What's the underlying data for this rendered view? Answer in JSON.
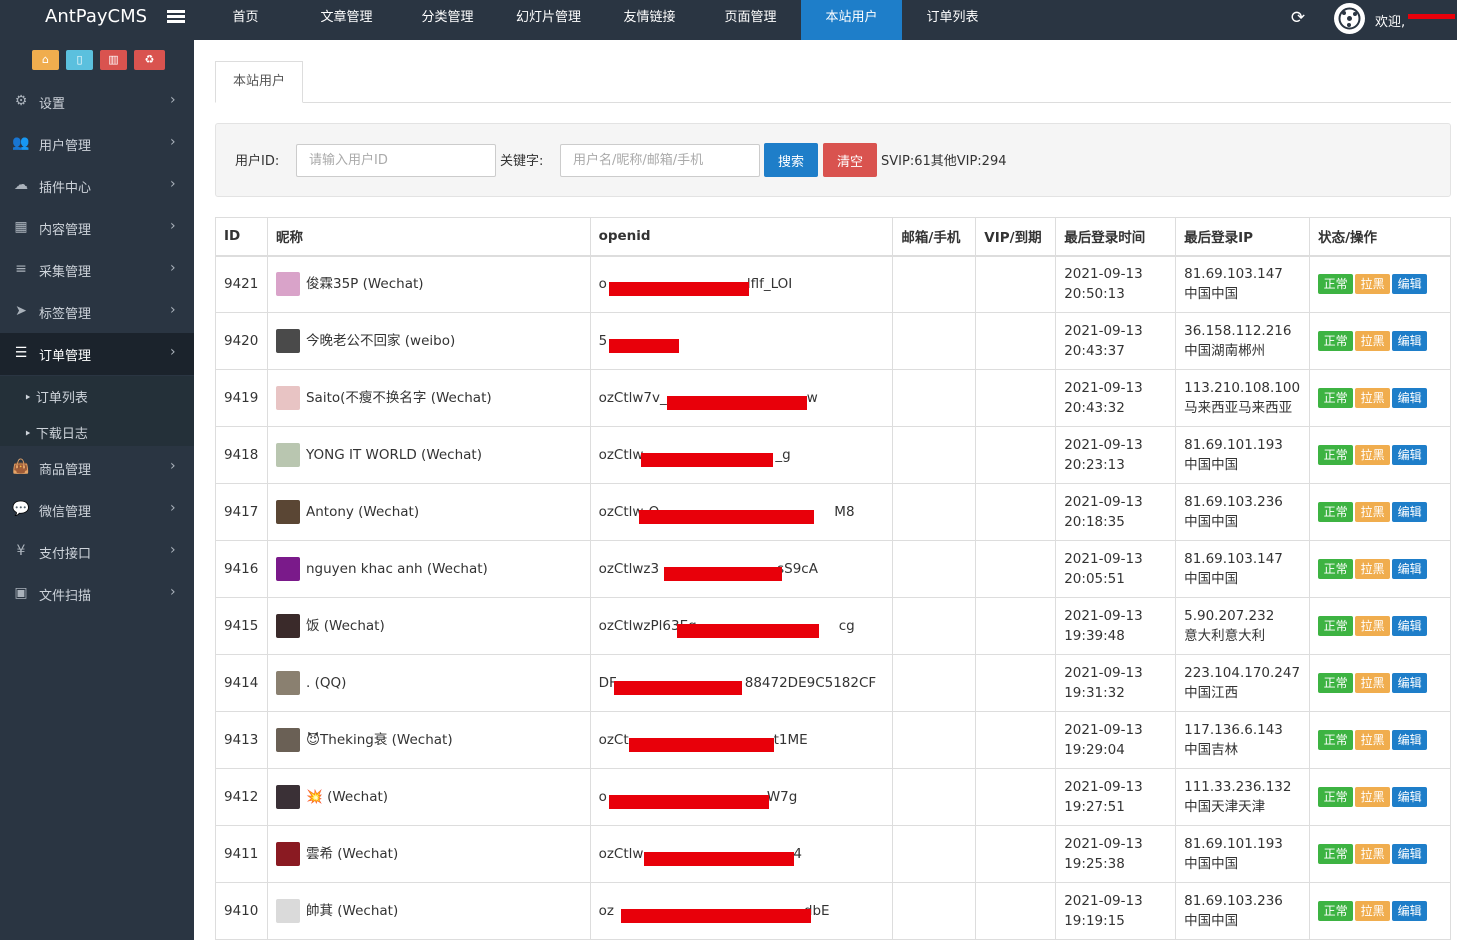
{
  "brand": "AntPayCMS",
  "top_nav": [
    "首页",
    "文章管理",
    "分类管理",
    "幻灯片管理",
    "友情链接",
    "页面管理",
    "本站用户",
    "订单列表"
  ],
  "top_nav_active": "本站用户",
  "welcome": "欢迎,",
  "sidebar": {
    "items": [
      {
        "label": "设置",
        "icon": "gears-icon"
      },
      {
        "label": "用户管理",
        "icon": "users-icon"
      },
      {
        "label": "插件中心",
        "icon": "cloud-icon"
      },
      {
        "label": "内容管理",
        "icon": "grid-icon"
      },
      {
        "label": "采集管理",
        "icon": "database-icon"
      },
      {
        "label": "标签管理",
        "icon": "send-icon"
      },
      {
        "label": "订单管理",
        "icon": "list-icon"
      },
      {
        "label": "商品管理",
        "icon": "shopping-bag-icon"
      },
      {
        "label": "微信管理",
        "icon": "wechat-icon"
      },
      {
        "label": "支付接口",
        "icon": "yen-icon"
      },
      {
        "label": "文件扫描",
        "icon": "image-icon"
      }
    ],
    "active": "订单管理",
    "sub_items": [
      "订单列表",
      "下载日志"
    ]
  },
  "tab": "本站用户",
  "filter": {
    "uid_label": "用户ID:",
    "uid_placeholder": "请输入用户ID",
    "kw_label": "关键字:",
    "kw_placeholder": "用户名/昵称/邮箱/手机",
    "search": "搜索",
    "clear": "清空",
    "vip_summary": "SVIP:61其他VIP:294"
  },
  "columns": [
    "ID",
    "昵称",
    "openid",
    "邮箱/手机",
    "VIP/到期",
    "最后登录时间",
    "最后登录IP",
    "状态/操作"
  ],
  "actions": {
    "ok": "正常",
    "black": "拉黑",
    "edit": "编辑"
  },
  "rows": [
    {
      "id": "9421",
      "nick": "俊霖35P (Wechat)",
      "openid": "o",
      "openid_tail": "lflf_LOI",
      "date": "2021-09-13",
      "time": "20:50:13",
      "ip": "81.69.103.147",
      "loc": "中国中国",
      "av": "#d9a3c9"
    },
    {
      "id": "9420",
      "nick": "今晚老公不回家 (weibo)",
      "openid": "5",
      "openid_tail": "",
      "date": "2021-09-13",
      "time": "20:43:37",
      "ip": "36.158.112.216",
      "loc": "中国湖南郴州",
      "av": "#4a4a4a"
    },
    {
      "id": "9419",
      "nick": "Saito(不瘦不换名字 (Wechat)",
      "openid": "ozCtlw7v_",
      "openid_tail": "w",
      "date": "2021-09-13",
      "time": "20:43:32",
      "ip": "113.210.108.100",
      "loc": "马来西亚马来西亚",
      "av": "#e8c4c4"
    },
    {
      "id": "9418",
      "nick": "YONG IT WORLD (Wechat)",
      "openid": "ozCtlw",
      "openid_tail": "_g",
      "date": "2021-09-13",
      "time": "20:23:13",
      "ip": "81.69.101.193",
      "loc": "中国中国",
      "av": "#b9c6b0"
    },
    {
      "id": "9417",
      "nick": "Antony (Wechat)",
      "openid": "ozCtlw-O",
      "openid_tail": "M8",
      "date": "2021-09-13",
      "time": "20:18:35",
      "ip": "81.69.103.236",
      "loc": "中国中国",
      "av": "#5a4634"
    },
    {
      "id": "9416",
      "nick": "nguyen khac anh (Wechat)",
      "openid": "ozCtlwz3",
      "openid_tail": "sS9cA",
      "date": "2021-09-13",
      "time": "20:05:51",
      "ip": "81.69.103.147",
      "loc": "中国中国",
      "av": "#7a1a8a"
    },
    {
      "id": "9415",
      "nick": "饭 (Wechat)",
      "openid": "ozCtlwzPl63Eq",
      "openid_tail": "cg",
      "date": "2021-09-13",
      "time": "19:39:48",
      "ip": "5.90.207.232",
      "loc": "意大利意大利",
      "av": "#3a2a2a"
    },
    {
      "id": "9414",
      "nick": ". (QQ)",
      "openid": "DF",
      "openid_tail": "88472DE9C5182CF",
      "date": "2021-09-13",
      "time": "19:31:32",
      "ip": "223.104.170.247",
      "loc": "中国江西",
      "av": "#8a8070"
    },
    {
      "id": "9413",
      "nick": "😈Theking衰 (Wechat)",
      "openid": "ozCt",
      "openid_tail": "t1ME",
      "date": "2021-09-13",
      "time": "19:29:04",
      "ip": "117.136.6.143",
      "loc": "中国吉林",
      "av": "#6a6055"
    },
    {
      "id": "9412",
      "nick": "💥 (Wechat)",
      "openid": "o",
      "openid_tail": "W7g",
      "date": "2021-09-13",
      "time": "19:27:51",
      "ip": "111.33.236.132",
      "loc": "中国天津天津",
      "av": "#3a3036"
    },
    {
      "id": "9411",
      "nick": "雲希 (Wechat)",
      "openid": "ozCtlw",
      "openid_tail": "4",
      "date": "2021-09-13",
      "time": "19:25:38",
      "ip": "81.69.101.193",
      "loc": "中国中国",
      "av": "#8a1a22"
    },
    {
      "id": "9410",
      "nick": "帥萁 (Wechat)",
      "openid": "oz",
      "openid_tail": "dbE",
      "date": "2021-09-13",
      "time": "19:19:15",
      "ip": "81.69.103.236",
      "loc": "中国中国",
      "av": "#dadada"
    }
  ],
  "colors": {
    "accent": "#1e7ec9",
    "sidebar": "#2a3542",
    "redaction": "#e8000a",
    "ok": "#3db342",
    "black": "#f0ad4e",
    "danger": "#d9534f"
  }
}
